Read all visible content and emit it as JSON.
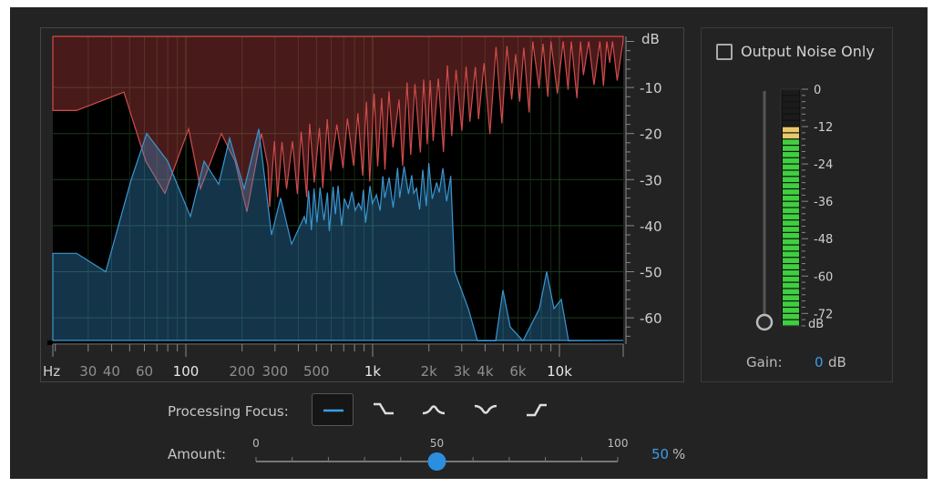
{
  "graph": {
    "db_unit": "dB",
    "db_ticks": [
      "-10",
      "-20",
      "-30",
      "-40",
      "-50",
      "-60"
    ],
    "freq_unit": "Hz",
    "freq_ticks": [
      {
        "label": "30",
        "hz": 30,
        "bright": false
      },
      {
        "label": "40",
        "hz": 40,
        "bright": false
      },
      {
        "label": "60",
        "hz": 60,
        "bright": false
      },
      {
        "label": "100",
        "hz": 100,
        "bright": true
      },
      {
        "label": "200",
        "hz": 200,
        "bright": false
      },
      {
        "label": "300",
        "hz": 300,
        "bright": false
      },
      {
        "label": "500",
        "hz": 500,
        "bright": false
      },
      {
        "label": "1k",
        "hz": 1000,
        "bright": true
      },
      {
        "label": "2k",
        "hz": 2000,
        "bright": false
      },
      {
        "label": "3k",
        "hz": 3000,
        "bright": false
      },
      {
        "label": "4k",
        "hz": 4000,
        "bright": false
      },
      {
        "label": "6k",
        "hz": 6000,
        "bright": false
      },
      {
        "label": "10k",
        "hz": 10000,
        "bright": true
      }
    ],
    "colors": {
      "noise": "#d24b4b",
      "signal": "#3a96d2"
    }
  },
  "output_noise_only": {
    "label": "Output Noise Only",
    "checked": false
  },
  "meter": {
    "ticks": [
      "0",
      "-12",
      "-24",
      "-36",
      "-48",
      "-60",
      "-72"
    ],
    "unit": "dB",
    "level_db": -11
  },
  "gain": {
    "label": "Gain:",
    "value": "0",
    "unit": "dB"
  },
  "processing_focus": {
    "label": "Processing Focus:",
    "options": [
      "flat",
      "high-shelf-cut",
      "mid-boost",
      "mid-cut",
      "low-shelf-cut"
    ],
    "selected": 0
  },
  "amount": {
    "label": "Amount:",
    "min_label": "0",
    "mid_label": "50",
    "max_label": "100",
    "value": 50,
    "value_text": "50",
    "unit": "%"
  }
}
